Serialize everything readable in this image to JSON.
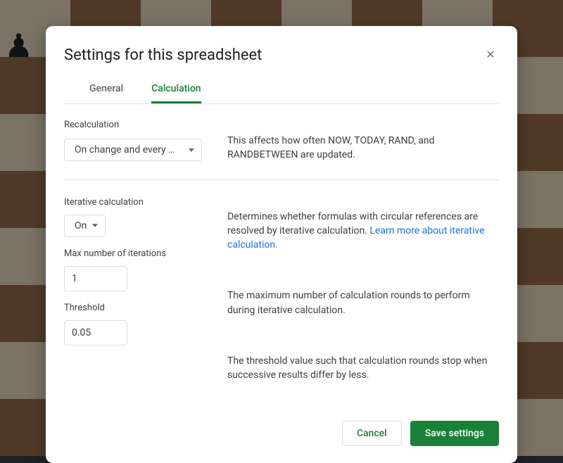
{
  "dialog": {
    "title": "Settings for this spreadsheet"
  },
  "tabs": {
    "general": "General",
    "calculation": "Calculation"
  },
  "recalc": {
    "label": "Recalculation",
    "value": "On change and every min…",
    "help": "This affects how often NOW, TODAY, RAND, and RANDBETWEEN are updated."
  },
  "iter": {
    "label": "Iterative calculation",
    "value": "On",
    "help_prefix": "Determines whether formulas with circular references are resolved by iterative calculation. ",
    "link_text": "Learn more about iterative calculation.",
    "max_label": "Max number of iterations",
    "max_value": "1",
    "max_help": "The maximum number of calculation rounds to perform during iterative calculation.",
    "threshold_label": "Threshold",
    "threshold_value": "0.05",
    "threshold_help": "The threshold value such that calculation rounds stop when successive results differ by less."
  },
  "footer": {
    "cancel": "Cancel",
    "save": "Save settings"
  }
}
